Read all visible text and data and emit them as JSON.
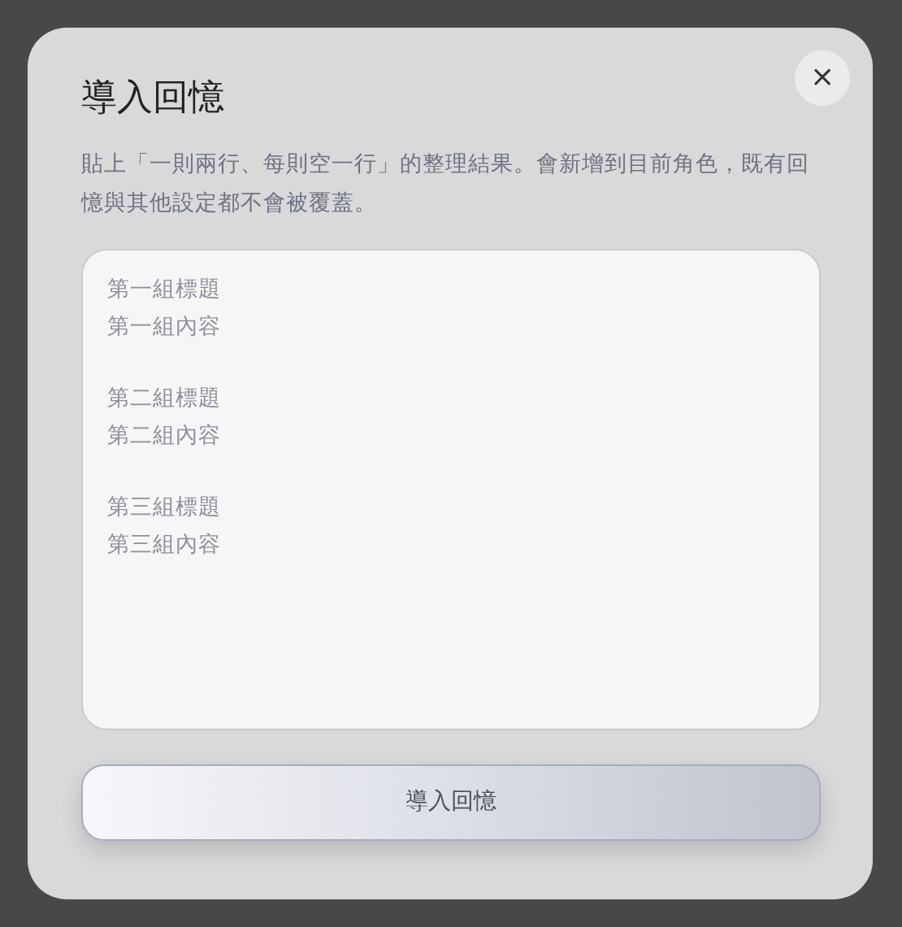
{
  "dialog": {
    "title": "導入回憶",
    "description": "貼上「一則兩行、每則空一行」的整理結果。會新增到目前角色，既有回憶與其他設定都不會被覆蓋。",
    "close": "×",
    "textarea": {
      "placeholder_groups": [
        [
          "第一組標題",
          "第一組內容"
        ],
        [
          "第二組標題",
          "第二組內容"
        ],
        [
          "第三組標題",
          "第三組內容"
        ]
      ]
    },
    "submit": "導入回憶"
  }
}
